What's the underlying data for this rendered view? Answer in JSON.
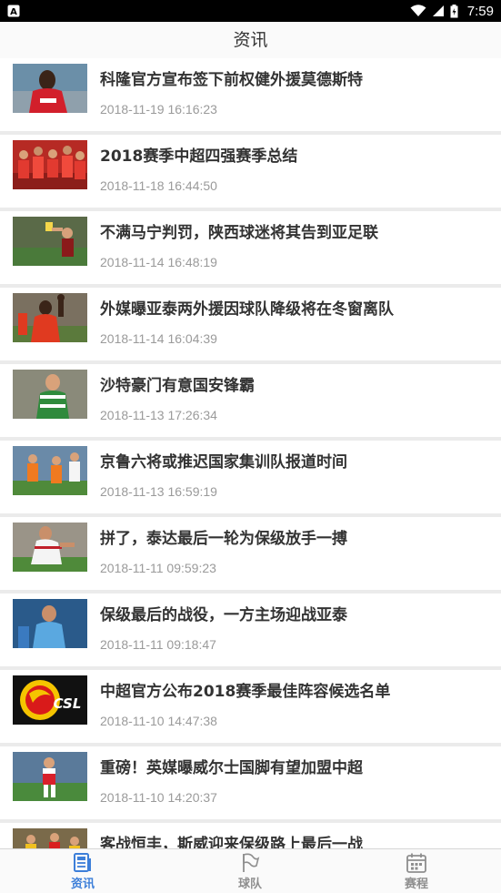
{
  "status_bar": {
    "time": "7:59"
  },
  "header": {
    "title": "资讯"
  },
  "news": [
    {
      "title": "科隆官方宣布签下前权健外援莫德斯特",
      "date": "2018-11-19 16:16:23",
      "thumb": "player-red"
    },
    {
      "title": "2018赛季中超四强赛季总结",
      "date": "2018-11-18 16:44:50",
      "thumb": "team-celebration"
    },
    {
      "title": "不满马宁判罚，陕西球迷将其告到亚足联",
      "date": "2018-11-14 16:48:19",
      "thumb": "referee"
    },
    {
      "title": "外媒曝亚泰两外援因球队降级将在冬窗离队",
      "date": "2018-11-14 16:04:39",
      "thumb": "player-red-fist"
    },
    {
      "title": "沙特豪门有意国安锋霸",
      "date": "2018-11-13 17:26:34",
      "thumb": "player-green"
    },
    {
      "title": "京鲁六将或推迟国家集训队报道时间",
      "date": "2018-11-13 16:59:19",
      "thumb": "players-orange"
    },
    {
      "title": "拼了，泰达最后一轮为保级放手一搏",
      "date": "2018-11-11 09:59:23",
      "thumb": "player-white"
    },
    {
      "title": "保级最后的战役，一方主场迎战亚泰",
      "date": "2018-11-11 09:18:47",
      "thumb": "player-blue"
    },
    {
      "title": "中超官方公布2018赛季最佳阵容候选名单",
      "date": "2018-11-10 14:47:38",
      "thumb": "csl-logo"
    },
    {
      "title": "重磅！英媒曝威尔士国脚有望加盟中超",
      "date": "2018-11-10 14:20:37",
      "thumb": "player-arsenal"
    },
    {
      "title": "客战恒丰，斯威迎来保级路上最后一战",
      "date": "",
      "thumb": "players-yellow-red"
    }
  ],
  "bottom_nav": [
    {
      "label": "资讯",
      "icon": "news-icon",
      "active": true
    },
    {
      "label": "球队",
      "icon": "flag-icon",
      "active": false
    },
    {
      "label": "赛程",
      "icon": "calendar-icon",
      "active": false
    }
  ],
  "colors": {
    "accent": "#3d7fd9",
    "inactive": "#8e8e8e",
    "title_text": "#333333",
    "date_text": "#9a9a9a"
  }
}
